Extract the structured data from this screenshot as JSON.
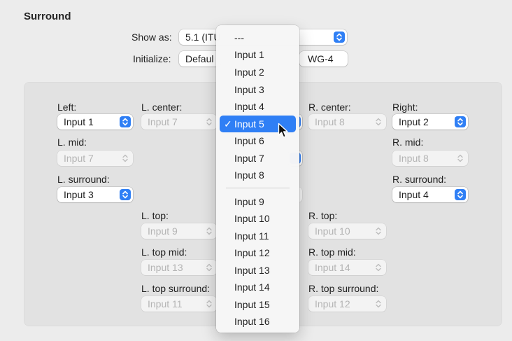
{
  "section": {
    "title": "Surround"
  },
  "show_as": {
    "label": "Show as:",
    "value": "5.1 (ITU"
  },
  "initialize": {
    "label": "Initialize:",
    "value": "Defaul",
    "value2": "WG-4"
  },
  "channels": {
    "left": {
      "label": "Left:",
      "value": "Input 1"
    },
    "l_center": {
      "label": "L. center:",
      "value": "Input 7"
    },
    "r_center": {
      "label": "R. center:",
      "value": "Input 8"
    },
    "right": {
      "label": "Right:",
      "value": "Input 2"
    },
    "l_mid": {
      "label": "L. mid:",
      "value": "Input 7"
    },
    "r_mid": {
      "label": "R. mid:",
      "value": "Input 8"
    },
    "l_surround": {
      "label": "L. surround:",
      "value": "Input 3"
    },
    "r_surround": {
      "label": "R. surround:",
      "value": "Input 4"
    },
    "l_top": {
      "label": "L. top:",
      "value": "Input 9"
    },
    "r_top": {
      "label": "R. top:",
      "value": "Input 10"
    },
    "l_top_mid": {
      "label": "L. top mid:",
      "value": "Input 13"
    },
    "r_top_mid": {
      "label": "R. top mid:",
      "value": "Input 14"
    },
    "l_top_surround": {
      "label": "L. top surround:",
      "value": "Input 11"
    },
    "r_top_surround": {
      "label": "R. top surround:",
      "value": "Input 12"
    }
  },
  "menu": {
    "checkmark": "✓",
    "selected_index": 5,
    "items": [
      "---",
      "Input 1",
      "Input 2",
      "Input 3",
      "Input 4",
      "Input 5",
      "Input 6",
      "Input 7",
      "Input 8",
      "Input 9",
      "Input 10",
      "Input 11",
      "Input 12",
      "Input 13",
      "Input 14",
      "Input 15",
      "Input 16"
    ]
  },
  "colors": {
    "accent": "#2f7ff5",
    "window_bg": "#ececec",
    "panel_bg": "#e2e2e2"
  },
  "icons": {
    "stepper": "updown-chevron-icon",
    "cursor": "mouse-pointer-icon"
  }
}
